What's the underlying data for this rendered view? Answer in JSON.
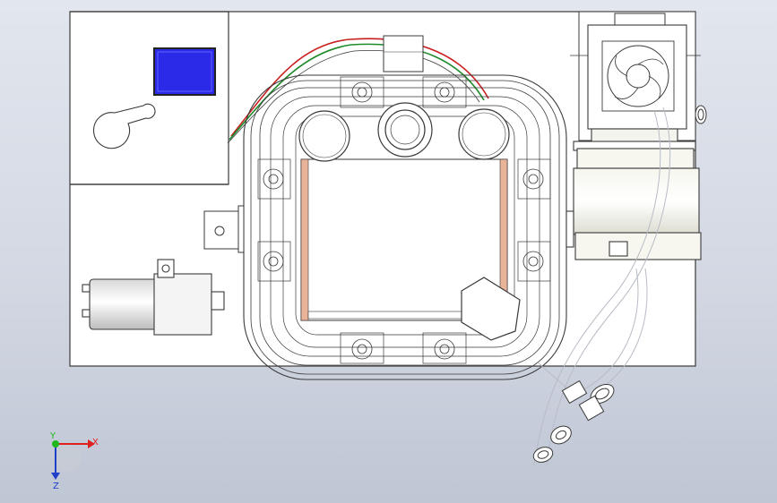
{
  "viewport": {
    "triad": {
      "x_label": "X",
      "y_label": "Y",
      "z_label": "Z",
      "x_color": "#e0201c",
      "y_color": "#1fb81f",
      "z_color": "#2040c8"
    },
    "colors": {
      "background_top": "#e2e6ee",
      "background_bottom": "#bfc6d4",
      "plate_fill": "#ffffff",
      "line": "#3a3a3a",
      "panel_screen": "#2a2ae8",
      "copper_strip": "#e9b39a",
      "wire_red": "#c81e1e",
      "wire_green": "#1f8a2a"
    }
  }
}
